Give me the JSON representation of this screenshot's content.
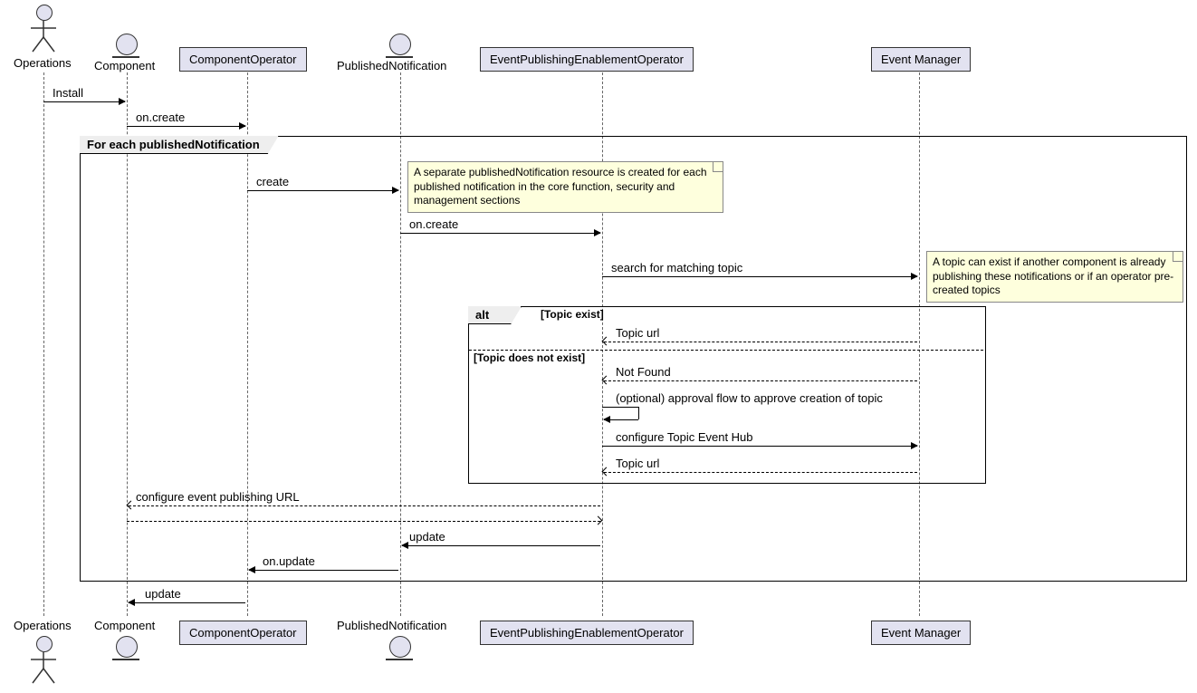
{
  "participants": {
    "operations": "Operations",
    "component": "Component",
    "componentOperator": "ComponentOperator",
    "publishedNotification": "PublishedNotification",
    "epeOperator": "EventPublishingEnablementOperator",
    "eventManager": "Event Manager"
  },
  "messages": {
    "install": "Install",
    "onCreate1": "on.create",
    "create": "create",
    "onCreate2": "on.create",
    "searchTopic": "search for matching topic",
    "topicUrl1": "Topic url",
    "notFound": "Not Found",
    "approvalFlow": "(optional) approval flow to approve creation of topic",
    "configureHub": "configure Topic Event Hub",
    "topicUrl2": "Topic url",
    "configureUrl": "configure event publishing URL",
    "update1": "update",
    "onUpdate": "on.update",
    "update2": "update"
  },
  "frames": {
    "loop": "For each publishedNotification",
    "alt": "alt",
    "guard1": "[Topic exist]",
    "guard2": "[Topic does not exist]"
  },
  "notes": {
    "note1": "A separate publishedNotification resource is created for each published notification in the core function, security and management sections",
    "note2": "A topic can exist if another component is already publishing these notifications or if an operator pre-created topics"
  },
  "chart_data": {
    "type": "sequence_diagram",
    "participants": [
      {
        "name": "Operations",
        "type": "actor"
      },
      {
        "name": "Component",
        "type": "entity"
      },
      {
        "name": "ComponentOperator",
        "type": "participant"
      },
      {
        "name": "PublishedNotification",
        "type": "entity"
      },
      {
        "name": "EventPublishingEnablementOperator",
        "type": "participant"
      },
      {
        "name": "Event Manager",
        "type": "participant"
      }
    ],
    "interactions": [
      {
        "from": "Operations",
        "to": "Component",
        "label": "Install",
        "type": "sync"
      },
      {
        "from": "Component",
        "to": "ComponentOperator",
        "label": "on.create",
        "type": "sync"
      },
      {
        "fragment": "loop",
        "label": "For each publishedNotification",
        "children": [
          {
            "from": "ComponentOperator",
            "to": "PublishedNotification",
            "label": "create",
            "type": "sync",
            "note": "A separate publishedNotification resource is created for each published notification in the core function, security and management sections"
          },
          {
            "from": "PublishedNotification",
            "to": "EventPublishingEnablementOperator",
            "label": "on.create",
            "type": "sync"
          },
          {
            "from": "EventPublishingEnablementOperator",
            "to": "Event Manager",
            "label": "search for matching topic",
            "type": "sync",
            "note": "A topic can exist if another component is already publishing these notifications or if an operator pre-created topics"
          },
          {
            "fragment": "alt",
            "branches": [
              {
                "guard": "[Topic exist]",
                "children": [
                  {
                    "from": "Event Manager",
                    "to": "EventPublishingEnablementOperator",
                    "label": "Topic url",
                    "type": "return"
                  }
                ]
              },
              {
                "guard": "[Topic does not exist]",
                "children": [
                  {
                    "from": "Event Manager",
                    "to": "EventPublishingEnablementOperator",
                    "label": "Not Found",
                    "type": "return"
                  },
                  {
                    "from": "EventPublishingEnablementOperator",
                    "to": "EventPublishingEnablementOperator",
                    "label": "(optional) approval flow to approve creation of topic",
                    "type": "self"
                  },
                  {
                    "from": "EventPublishingEnablementOperator",
                    "to": "Event Manager",
                    "label": "configure Topic Event Hub",
                    "type": "sync"
                  },
                  {
                    "from": "Event Manager",
                    "to": "EventPublishingEnablementOperator",
                    "label": "Topic url",
                    "type": "return"
                  }
                ]
              }
            ]
          },
          {
            "from": "EventPublishingEnablementOperator",
            "to": "Component",
            "label": "configure event publishing URL",
            "type": "return"
          },
          {
            "from": "Component",
            "to": "EventPublishingEnablementOperator",
            "label": "",
            "type": "return"
          },
          {
            "from": "EventPublishingEnablementOperator",
            "to": "PublishedNotification",
            "label": "update",
            "type": "sync"
          },
          {
            "from": "PublishedNotification",
            "to": "ComponentOperator",
            "label": "on.update",
            "type": "sync"
          }
        ]
      },
      {
        "from": "ComponentOperator",
        "to": "Component",
        "label": "update",
        "type": "sync"
      }
    ]
  }
}
